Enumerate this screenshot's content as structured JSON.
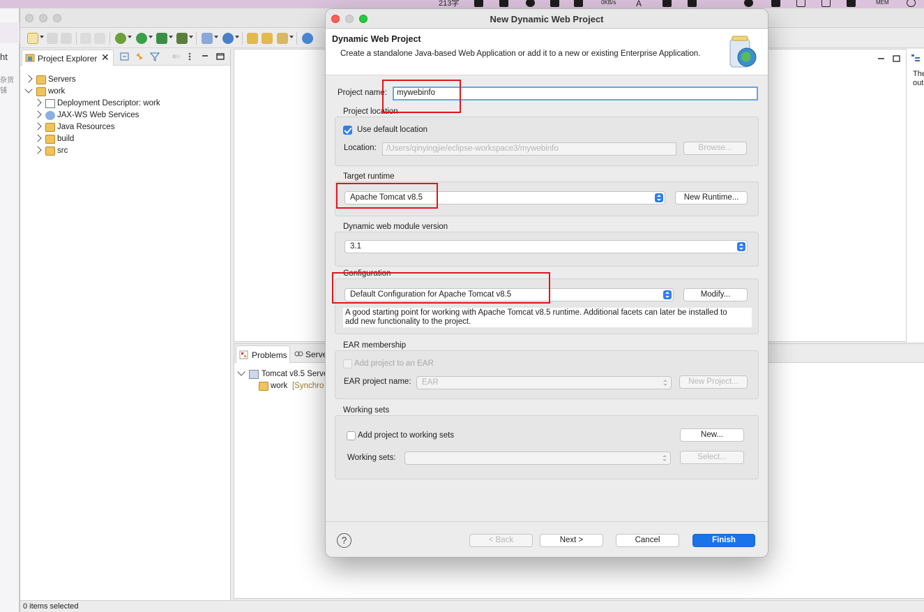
{
  "menubar": {
    "left_text": "213字",
    "speed": "0KB/s",
    "mem": "MEM"
  },
  "background_browser": {
    "text1": "ht",
    "text2": "杂货铺"
  },
  "project_explorer": {
    "tab_label": "Project Explorer",
    "tree": [
      {
        "label": "Servers"
      },
      {
        "label": "work"
      },
      {
        "label": "Deployment Descriptor: work"
      },
      {
        "label": "JAX-WS Web Services"
      },
      {
        "label": "Java Resources"
      },
      {
        "label": "build"
      },
      {
        "label": "src"
      }
    ]
  },
  "outline": {
    "text1": "The",
    "text2": "out"
  },
  "bottom_panel": {
    "tabs": [
      "Problems",
      "Serve"
    ],
    "server_row": "Tomcat v8.5 Serve",
    "module_row": "work",
    "module_status": "[Synchro"
  },
  "status_bar": {
    "text": "0 items selected"
  },
  "dialog": {
    "title": "New Dynamic Web Project",
    "heading": "Dynamic Web Project",
    "description": "Create a standalone Java-based Web Application or add it to a new or existing Enterprise Application.",
    "project_name_label": "Project name:",
    "project_name_value": "mywebinfo",
    "project_location": {
      "title": "Project location",
      "use_default_label": "Use default location",
      "use_default_checked": true,
      "location_label": "Location:",
      "location_value": "/Users/qinyingjie/eclipse-workspace3/mywebinfo",
      "browse_label": "Browse..."
    },
    "target_runtime": {
      "title": "Target runtime",
      "value": "Apache Tomcat v8.5",
      "new_runtime_label": "New Runtime..."
    },
    "module_version": {
      "title": "Dynamic web module version",
      "value": "3.1"
    },
    "configuration": {
      "title": "Configuration",
      "value": "Default Configuration for Apache Tomcat v8.5",
      "modify_label": "Modify...",
      "description_line1": "A good starting point for working with Apache Tomcat v8.5 runtime. Additional facets can later be installed to",
      "description_line2": "add new functionality to the project."
    },
    "ear_membership": {
      "title": "EAR membership",
      "add_label": "Add project to an EAR",
      "ear_name_label": "EAR project name:",
      "ear_name_value": "EAR",
      "new_project_label": "New Project..."
    },
    "working_sets": {
      "title": "Working sets",
      "add_label": "Add project to working sets",
      "new_label": "New...",
      "sets_label": "Working sets:",
      "select_label": "Select..."
    },
    "buttons": {
      "help": "?",
      "back": "< Back",
      "next": "Next >",
      "cancel": "Cancel",
      "finish": "Finish"
    }
  },
  "colors": {
    "highlight": "#e0141c",
    "accent": "#1a73e8",
    "focus": "#6aa3e8"
  }
}
